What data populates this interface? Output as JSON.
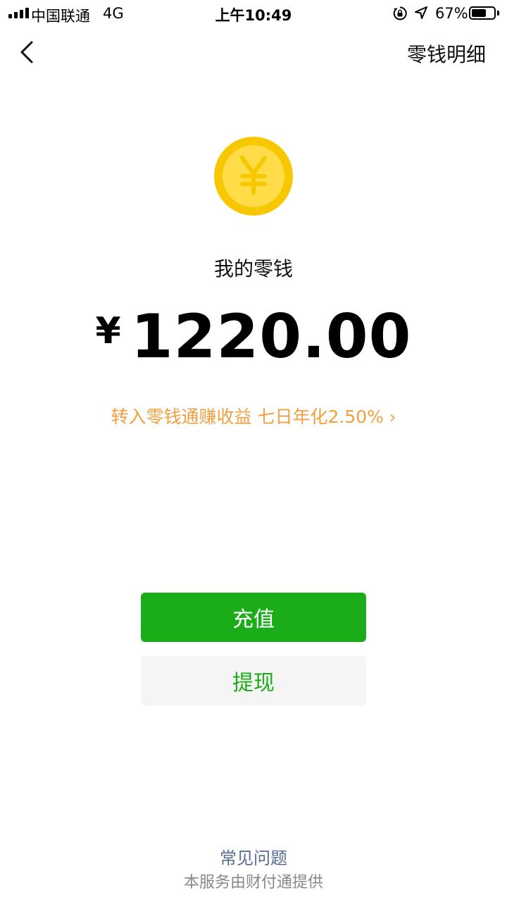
{
  "status_bar": {
    "carrier": "中国联通",
    "network": "4G",
    "time": "上午10:49",
    "battery_percent": "67%",
    "battery_level": 0.67
  },
  "nav": {
    "back_icon": "chevron-left-icon",
    "right_action": "零钱明细"
  },
  "wallet": {
    "coin_icon": "yuan-coin-icon",
    "label": "我的零钱",
    "currency_symbol": "¥",
    "amount": "1220.00",
    "promo_text": "转入零钱通赚收益 七日年化2.50%",
    "promo_chevron": "›"
  },
  "actions": {
    "recharge_label": "充值",
    "withdraw_label": "提现"
  },
  "footer": {
    "faq_label": "常见问题",
    "provider_note": "本服务由财付通提供"
  },
  "colors": {
    "primary_green": "#1aad19",
    "promo_orange": "#f0a040",
    "link_blue": "#576b95",
    "coin_outer": "#f7c800",
    "coin_inner": "#ffdc48"
  }
}
